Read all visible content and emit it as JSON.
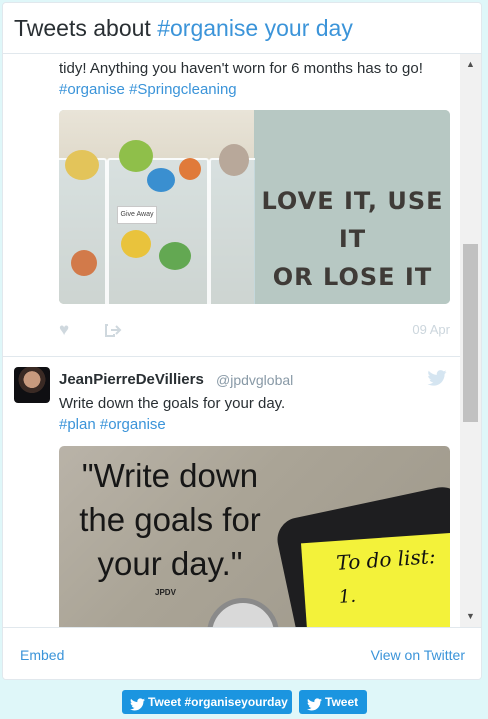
{
  "header": {
    "title_prefix": "Tweets about ",
    "title_hashtag": "#organise your day"
  },
  "tweet1": {
    "text": "tidy! Anything you haven't worn for 6 months has to go!",
    "tags": [
      "#organise",
      "#Springcleaning"
    ],
    "media": {
      "bin_label": "Give Away",
      "quote_line1": "LOVE IT, USE IT",
      "quote_line2": "OR LOSE IT"
    },
    "like_icon": "heart-icon",
    "share_icon": "share-icon",
    "date": "09 Apr"
  },
  "tweet2": {
    "author_name": "JeanPierreDeVilliers",
    "author_handle": "@jpdvglobal",
    "text": "Write down the goals for your day.",
    "tags": [
      "#plan",
      "#organise"
    ],
    "media": {
      "quote_line1": "\"Write down",
      "quote_line2": "the goals for",
      "quote_line3": "your day.\"",
      "credit": "JPDV",
      "todo_title": "To do list:",
      "todo_item": "1."
    },
    "brand_icon": "twitter-bird-icon"
  },
  "footer": {
    "embed_label": "Embed",
    "view_label": "View on Twitter"
  },
  "buttons": {
    "hashtag_tweet": "Tweet #organiseyourday",
    "tweet": "Tweet"
  },
  "colors": {
    "page_bg": "#dff7f9",
    "link": "#3b94d9",
    "button": "#1b95e0",
    "text": "#292f33",
    "muted": "#8899a6"
  }
}
